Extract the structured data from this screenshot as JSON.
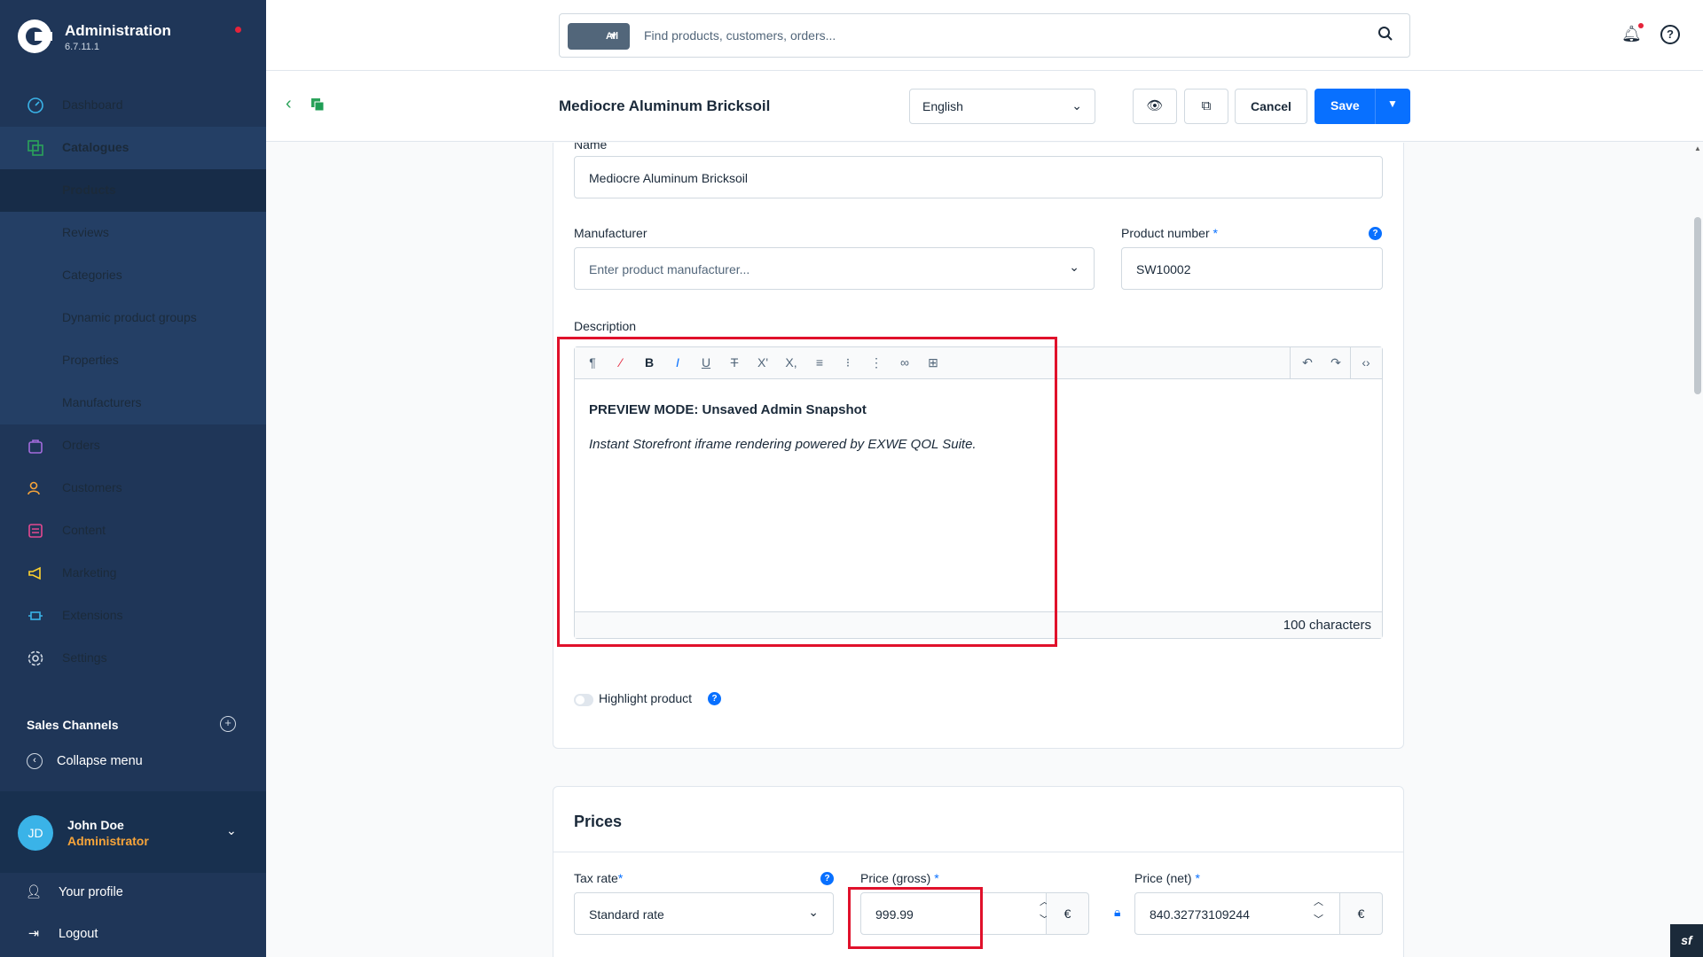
{
  "app": {
    "title": "Administration",
    "version": "6.7.11.1"
  },
  "nav": [
    {
      "label": "Dashboard",
      "icon": "dashboard-icon"
    },
    {
      "label": "Catalogues",
      "icon": "catalogues-icon"
    },
    {
      "label": "Products"
    },
    {
      "label": "Reviews"
    },
    {
      "label": "Categories"
    },
    {
      "label": "Dynamic product groups"
    },
    {
      "label": "Properties"
    },
    {
      "label": "Manufacturers"
    },
    {
      "label": "Orders",
      "icon": "orders-icon"
    },
    {
      "label": "Customers",
      "icon": "customers-icon"
    },
    {
      "label": "Content",
      "icon": "content-icon"
    },
    {
      "label": "Marketing",
      "icon": "marketing-icon"
    },
    {
      "label": "Extensions",
      "icon": "extensions-icon"
    },
    {
      "label": "Settings",
      "icon": "settings-icon"
    }
  ],
  "sales_channels": {
    "title": "Sales Channels",
    "collapse": "Collapse menu"
  },
  "user": {
    "initials": "JD",
    "name": "John Doe",
    "role": "Administrator",
    "profile": "Your profile",
    "logout": "Logout"
  },
  "search": {
    "scope": "All",
    "placeholder": "Find products, customers, orders..."
  },
  "header": {
    "title": "Mediocre Aluminum Bricksoil",
    "language": "English",
    "cancel": "Cancel",
    "save": "Save"
  },
  "form": {
    "name_label": "Name",
    "name_value": "Mediocre Aluminum Bricksoil",
    "manufacturer_label": "Manufacturer",
    "manufacturer_placeholder": "Enter product manufacturer...",
    "product_number_label": "Product number",
    "product_number_value": "SW10002",
    "description_label": "Description",
    "description_heading": "PREVIEW MODE: Unsaved Admin Snapshot",
    "description_text": "Instant Storefront iframe rendering powered by EXWE QOL Suite.",
    "char_count": "100 characters",
    "highlight_label": "Highlight product"
  },
  "prices": {
    "title": "Prices",
    "tax_label": "Tax rate",
    "tax_value": "Standard rate",
    "gross_label": "Price (gross)",
    "gross_value": "999.99",
    "net_label": "Price (net)",
    "net_value": "840.32773109244",
    "currency": "€"
  },
  "colors": {
    "sidebar": "#1f3658",
    "primary": "#0870ff",
    "highlight": "#e0112b",
    "role": "#f6a43a"
  }
}
